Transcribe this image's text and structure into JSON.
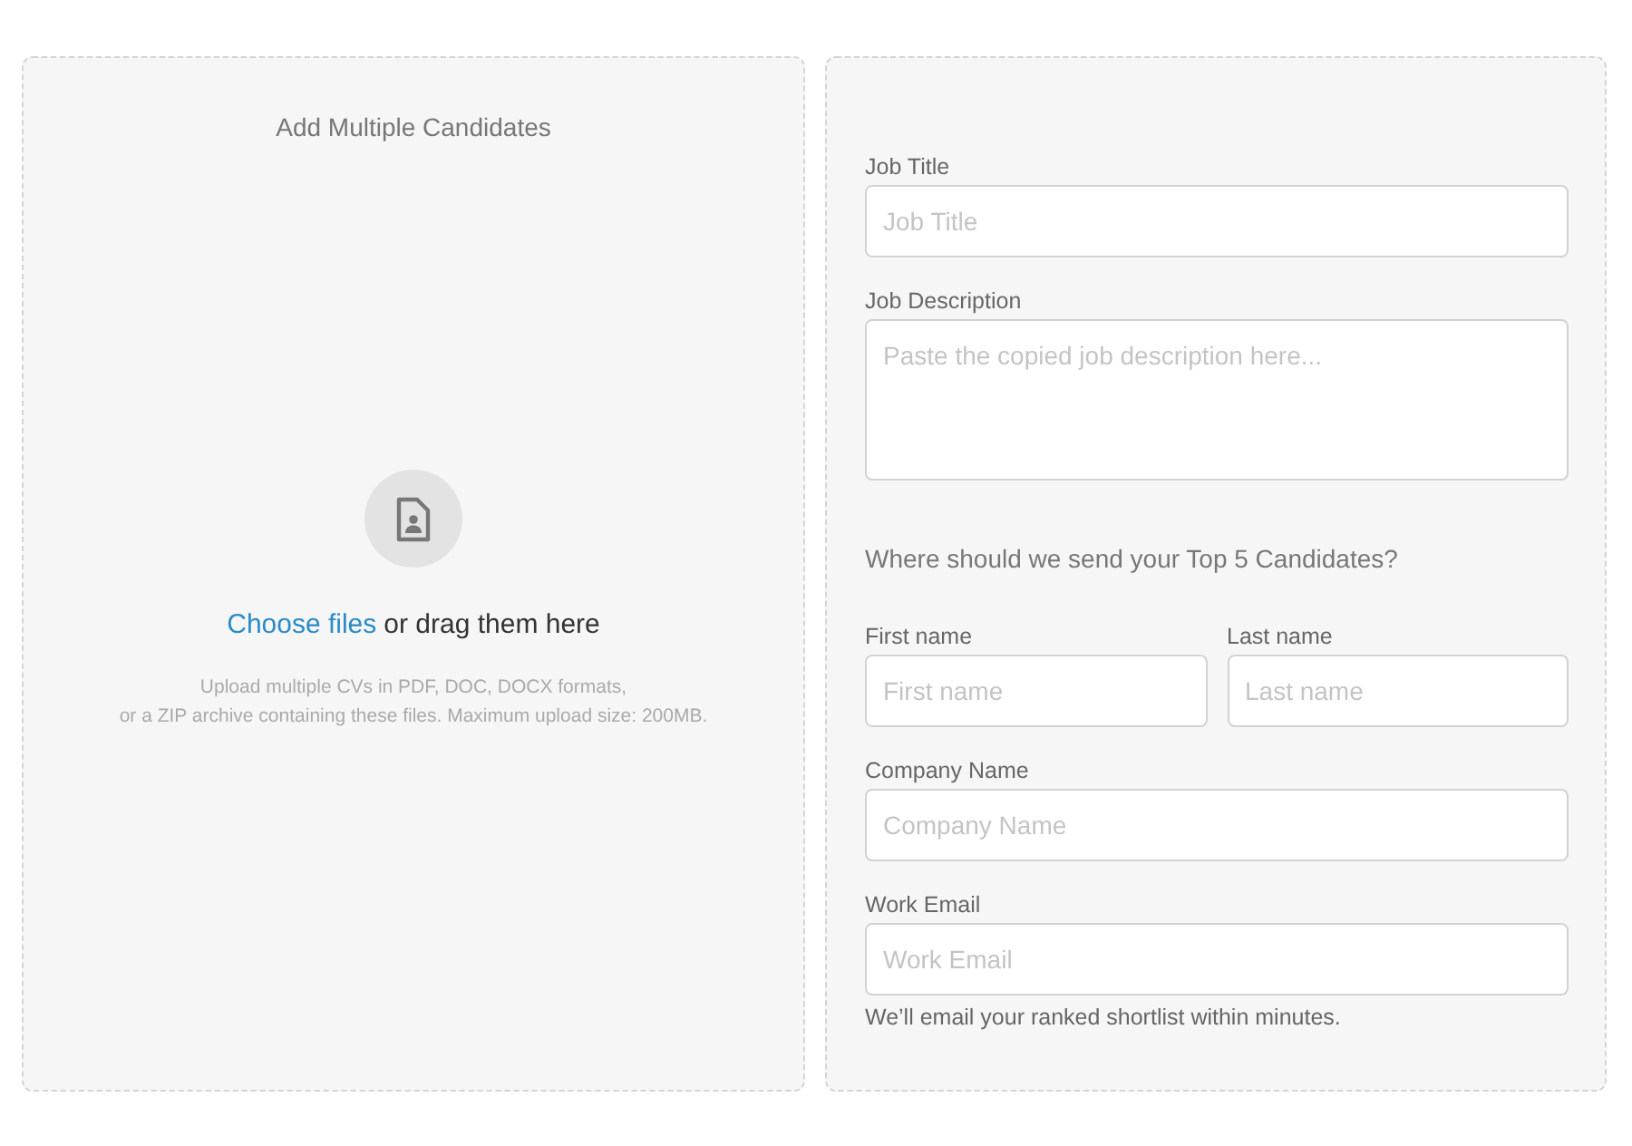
{
  "upload_panel": {
    "title": "Add Multiple Candidates",
    "choose_link": "Choose files",
    "drag_text": "or drag them here",
    "hint_lines": [
      "Upload multiple CVs in PDF, DOC, DOCX formats,",
      "or a ZIP archive containing these files. Maximum upload size: 200MB."
    ]
  },
  "form": {
    "job_fields": [
      {
        "kind": "input",
        "label": "Job Title",
        "placeholder": "Job Title"
      },
      {
        "kind": "textarea",
        "label": "Job Description",
        "placeholder": "Paste the copied job description here..."
      }
    ],
    "section_heading": "Where should we send your Top 5 Candidates?",
    "contact_rows": [
      {
        "fields": [
          {
            "kind": "input",
            "label": "First name",
            "placeholder": "First name"
          },
          {
            "kind": "input",
            "label": "Last name",
            "placeholder": "Last name"
          }
        ]
      },
      {
        "fields": [
          {
            "kind": "input",
            "label": "Company Name",
            "placeholder": "Company Name"
          }
        ]
      },
      {
        "fields": [
          {
            "kind": "input",
            "label": "Work Email",
            "placeholder": "Work Email"
          }
        ]
      }
    ],
    "note": "We’ll email your ranked shortlist within minutes."
  }
}
